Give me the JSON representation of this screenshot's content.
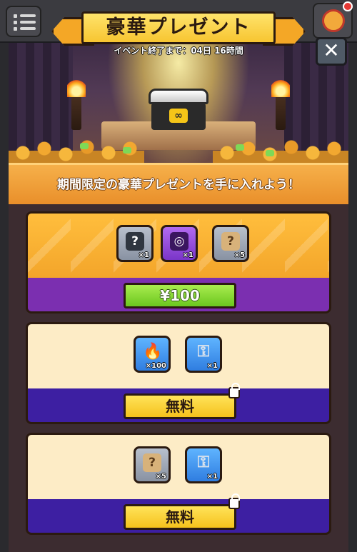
{
  "header": {
    "title": "豪華プレゼント",
    "countdown": "イベント終了まで：04日 16時間",
    "close_label": "✕"
  },
  "subheading": "期間限定の豪華プレゼントを手に入れよう！",
  "offers": [
    {
      "items": [
        {
          "icon": "gray-chest-icon",
          "glyph": "?",
          "qty": "×1"
        },
        {
          "icon": "purple-chest-icon",
          "glyph": "◎",
          "qty": "×1"
        },
        {
          "icon": "mystery-scroll-icon",
          "glyph": "?",
          "qty": "×5"
        }
      ],
      "price_label": "¥100",
      "locked": false
    },
    {
      "items": [
        {
          "icon": "fire-icon",
          "glyph": "🔥",
          "qty": "×100"
        },
        {
          "icon": "key-icon",
          "glyph": "⚿",
          "qty": "×1"
        }
      ],
      "price_label": "無料",
      "locked": true
    },
    {
      "items": [
        {
          "icon": "mystery-scroll-icon",
          "glyph": "?",
          "qty": "×5"
        },
        {
          "icon": "key-icon",
          "glyph": "⚿",
          "qty": "×1"
        }
      ],
      "price_label": "無料",
      "locked": true
    }
  ],
  "colors": {
    "accent_orange": "#f3a52a",
    "purple_band": "#7b2fb0",
    "indigo_band": "#3d1fa2",
    "buy_green": "#6bc71f",
    "free_yellow": "#f5c21c"
  }
}
